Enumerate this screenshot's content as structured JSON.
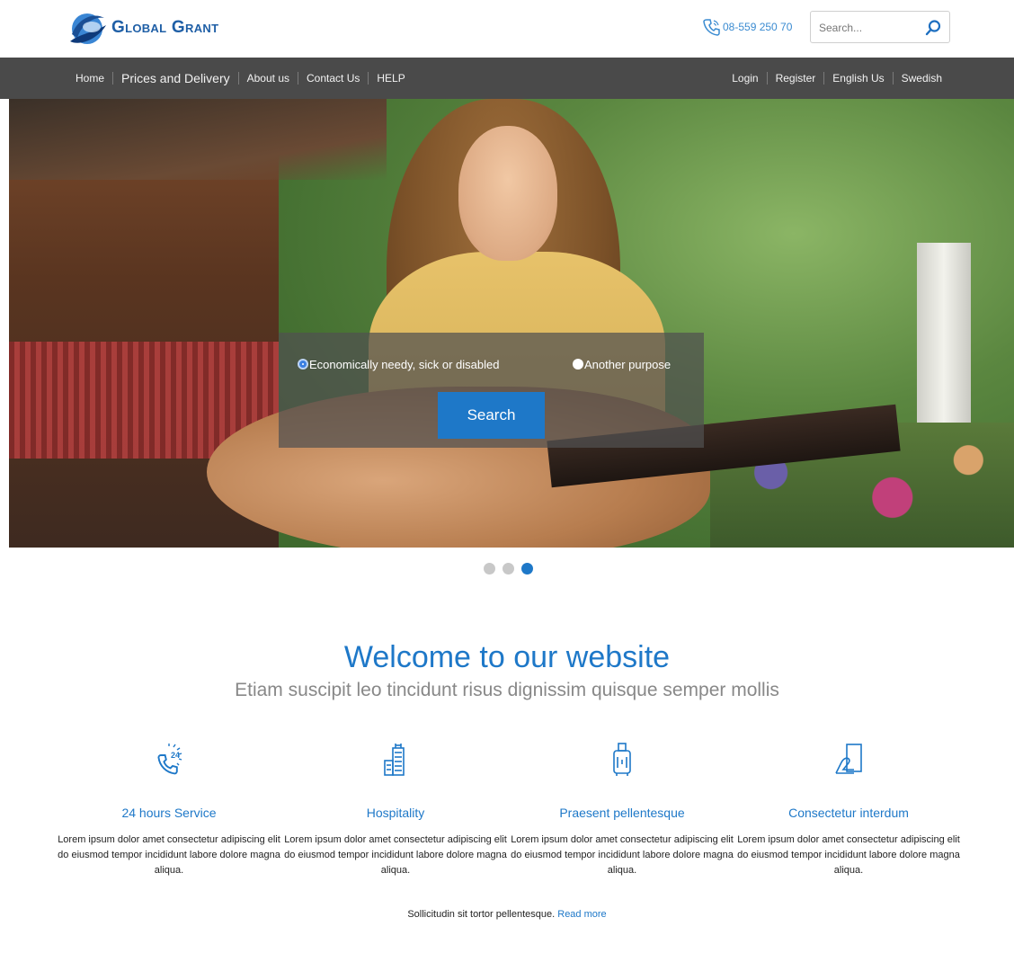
{
  "header": {
    "logo_text": "Global Grant",
    "phone": "08-559 250 70",
    "search_placeholder": "Search..."
  },
  "nav": {
    "left": [
      "Home",
      "Prices and Delivery",
      "About us",
      "Contact Us",
      "HELP"
    ],
    "right": [
      "Login",
      "Register",
      "English Us",
      "Swedish"
    ]
  },
  "hero": {
    "option_1": "Economically needy, sick or disabled",
    "option_2": "Another purpose",
    "selected_option": "option_1",
    "search_button": "Search",
    "slides_total": 3,
    "active_slide": 3
  },
  "welcome": {
    "title": "Welcome to our website",
    "subtitle": "Etiam suscipit leo tincidunt risus dignissim quisque semper mollis"
  },
  "features": [
    {
      "icon": "phone-24-icon",
      "title": "24 hours Service",
      "text": "Lorem ipsum dolor amet consectetur adipiscing elit do eiusmod tempor incididunt labore dolore magna aliqua."
    },
    {
      "icon": "hotel-building-icon",
      "title": "Hospitality",
      "text": "Lorem ipsum dolor amet consectetur adipiscing elit do eiusmod tempor incididunt labore dolore magna aliqua."
    },
    {
      "icon": "luggage-icon",
      "title": "Praesent pellentesque",
      "text": "Lorem ipsum dolor amet consectetur adipiscing elit do eiusmod tempor incididunt labore dolore magna aliqua."
    },
    {
      "icon": "hand-document-icon",
      "title": "Consectetur interdum",
      "text": "Lorem ipsum dolor amet consectetur adipiscing elit do eiusmod tempor incididunt labore dolore magna aliqua."
    }
  ],
  "footer_note": {
    "text": "Sollicitudin sit tortor pellentesque.",
    "link": "Read more"
  },
  "colors": {
    "accent": "#1e78c8",
    "nav_bg": "#4a4a4a"
  }
}
